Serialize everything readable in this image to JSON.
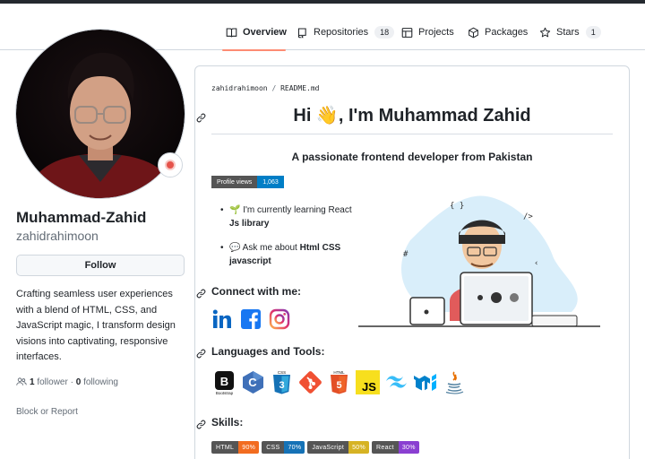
{
  "nav": {
    "tabs": [
      {
        "label": "Overview",
        "active": true
      },
      {
        "label": "Repositories",
        "count": "18"
      },
      {
        "label": "Projects"
      },
      {
        "label": "Packages"
      },
      {
        "label": "Stars",
        "count": "1"
      }
    ]
  },
  "profile": {
    "fullname": "Muhammad-Zahid",
    "username": "zahidrahimoon",
    "follow_label": "Follow",
    "bio": "Crafting seamless user experiences with a blend of HTML, CSS, and JavaScript magic, I transform design visions into captivating, responsive interfaces.",
    "followers_count": "1",
    "followers_label": "follower",
    "separator": "·",
    "following_count": "0",
    "following_label": "following",
    "block_report_label": "Block or Report"
  },
  "readme": {
    "path_owner": "zahidrahimoon",
    "path_sep": "/",
    "path_file": "README.md",
    "heading": "Hi 👋, I'm Muhammad Zahid",
    "subtitle": "A passionate frontend developer from Pakistan",
    "views_badge": {
      "label": "Profile views",
      "value": "1,063",
      "color": "#007ec6"
    },
    "bullets": [
      {
        "prefix": "🌱 I'm currently learning React ",
        "bold": "Js library"
      },
      {
        "prefix": "💬 Ask me about ",
        "bold": "Html CSS javascript"
      }
    ],
    "connect_heading": "Connect with me:",
    "social_icons": [
      "linkedin-icon",
      "facebook-icon",
      "instagram-icon"
    ],
    "tools_heading": "Languages and Tools:",
    "tools": [
      {
        "name": "bootstrap-icon",
        "caption": "Bootstrap"
      },
      {
        "name": "c-language-icon"
      },
      {
        "name": "css3-icon",
        "caption": "CSS"
      },
      {
        "name": "git-icon"
      },
      {
        "name": "html5-icon",
        "caption": "HTML"
      },
      {
        "name": "javascript-icon",
        "caption": "JS"
      },
      {
        "name": "tailwind-icon"
      },
      {
        "name": "mui-icon"
      },
      {
        "name": "java-icon"
      }
    ],
    "skills_heading": "Skills:",
    "skills": [
      {
        "label": "HTML",
        "value": "90%",
        "color": "#f26c20"
      },
      {
        "label": "CSS",
        "value": "70%",
        "color": "#1572b6"
      },
      {
        "label": "JavaScript",
        "value": "50%",
        "color": "#d6b324"
      },
      {
        "label": "React",
        "value": "30%",
        "color": "#8a3fd1"
      }
    ]
  }
}
